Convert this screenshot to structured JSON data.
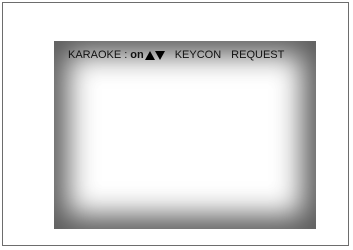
{
  "osd": {
    "label": "KARAOKE",
    "separator": ":",
    "value": "on",
    "adjust_icon": "up-down-triangle-icon",
    "options": [
      "KEYCON",
      "REQUEST"
    ]
  }
}
